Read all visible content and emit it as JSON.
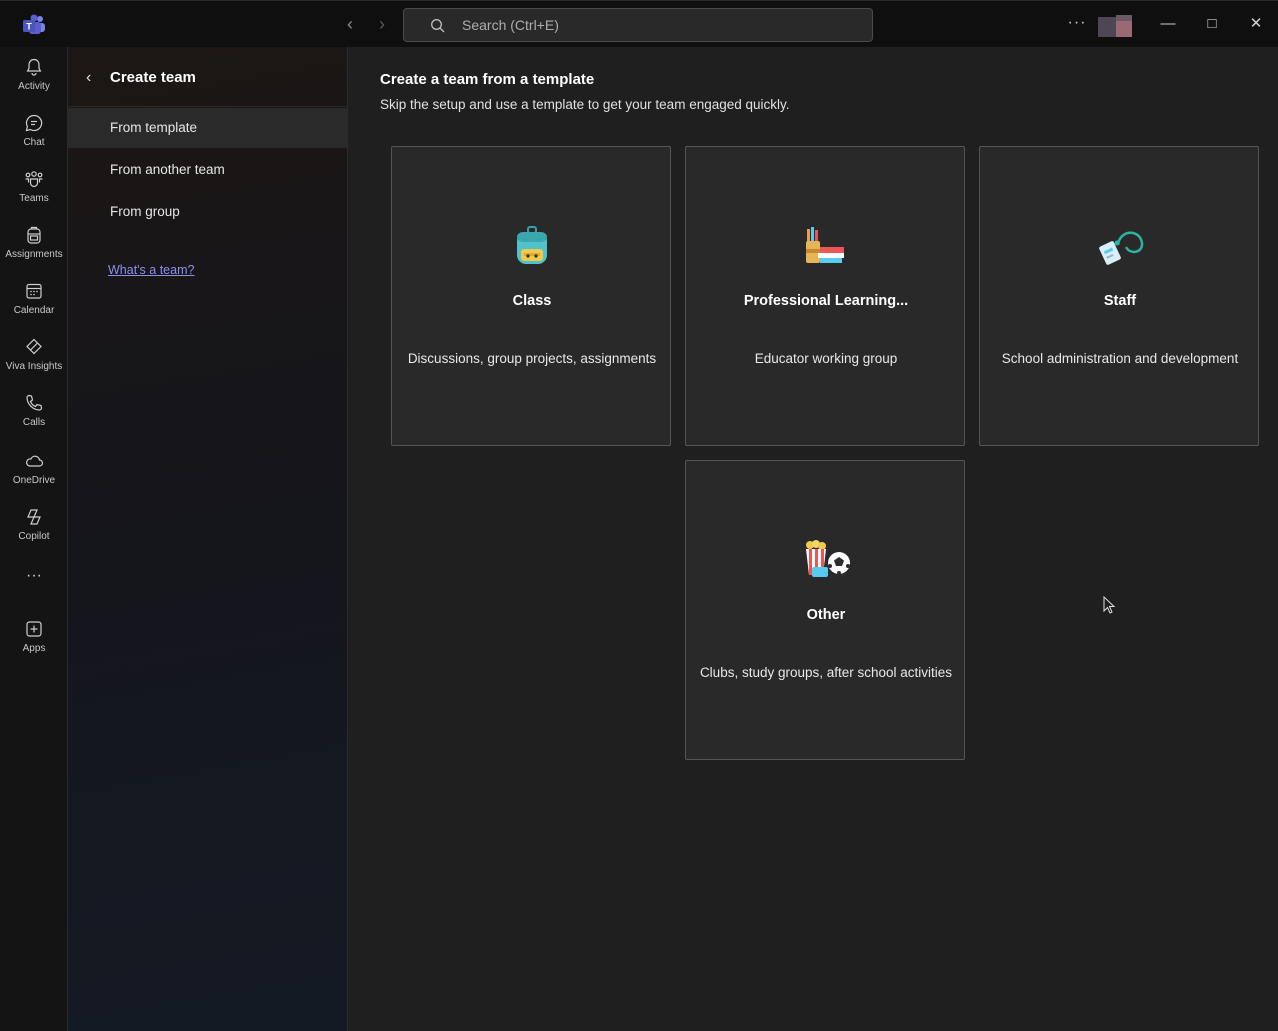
{
  "titlebar": {
    "search_placeholder": "Search (Ctrl+E)",
    "nav_back": "‹",
    "nav_forward": "›",
    "more": "···",
    "minimize": "—",
    "maximize": "□",
    "close": "✕"
  },
  "rail": {
    "items": [
      {
        "label": "Activity",
        "icon": "bell-icon"
      },
      {
        "label": "Chat",
        "icon": "chat-icon"
      },
      {
        "label": "Teams",
        "icon": "teams-icon"
      },
      {
        "label": "Assignments",
        "icon": "backpack-icon"
      },
      {
        "label": "Calendar",
        "icon": "calendar-icon"
      },
      {
        "label": "Viva Insights",
        "icon": "insights-icon"
      },
      {
        "label": "Calls",
        "icon": "phone-icon"
      },
      {
        "label": "OneDrive",
        "icon": "cloud-icon"
      },
      {
        "label": "Copilot",
        "icon": "copilot-icon"
      },
      {
        "label": "Apps",
        "icon": "plus-square-icon"
      }
    ],
    "more": "···"
  },
  "panel": {
    "back": "‹",
    "title": "Create team",
    "items": [
      {
        "label": "From template",
        "active": true
      },
      {
        "label": "From another team",
        "active": false
      },
      {
        "label": "From group",
        "active": false
      }
    ],
    "help_link": "What's a team?"
  },
  "main": {
    "title": "Create a team from a template",
    "subtitle": "Skip the setup and use a template to get your team engaged quickly.",
    "cards": [
      {
        "title": "Class",
        "description": "Discussions, group projects, assignments",
        "icon": "backpack-illustration-icon"
      },
      {
        "title": "Professional Learning...",
        "description": "Educator working group",
        "icon": "books-pencils-icon"
      },
      {
        "title": "Staff",
        "description": "School administration and development",
        "icon": "badge-lanyard-icon"
      },
      {
        "title": "Other",
        "description": "Clubs, study groups, after school activities",
        "icon": "popcorn-soccer-icon"
      }
    ]
  },
  "colors": {
    "accent": "#8e8ff0",
    "background": "#1f1f1f",
    "card": "#292929",
    "card_border": "#555555"
  }
}
